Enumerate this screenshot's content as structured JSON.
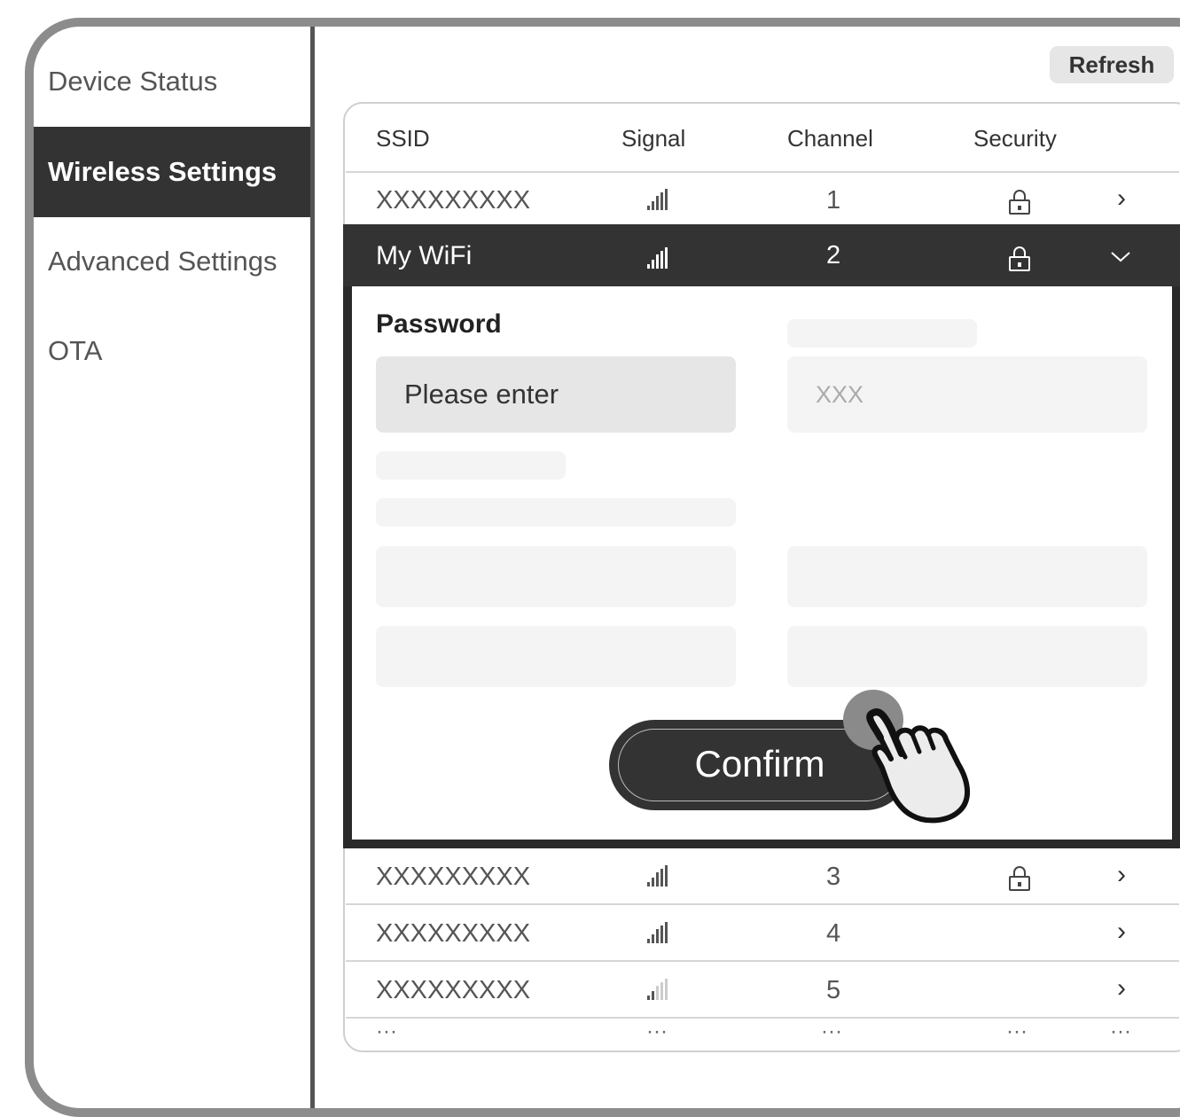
{
  "sidebar": {
    "items": [
      {
        "label": "Device Status",
        "active": false
      },
      {
        "label": "Wireless Settings",
        "active": true
      },
      {
        "label": "Advanced Settings",
        "active": false
      },
      {
        "label": "OTA",
        "active": false
      }
    ]
  },
  "toolbar": {
    "refresh_label": "Refresh"
  },
  "table": {
    "headers": [
      "SSID",
      "Signal",
      "Channel",
      "Security"
    ],
    "rows": [
      {
        "ssid": "XXXXXXXXX",
        "channel": "1",
        "secured": true,
        "signal_bars": 4
      },
      {
        "ssid": "My WiFi",
        "channel": "2",
        "secured": true,
        "signal_bars": 4,
        "expanded": true
      },
      {
        "ssid": "XXXXXXXXX",
        "channel": "3",
        "secured": true,
        "signal_bars": 4
      },
      {
        "ssid": "XXXXXXXXX",
        "channel": "4",
        "secured": false,
        "signal_bars": 4
      },
      {
        "ssid": "XXXXXXXXX",
        "channel": "5",
        "secured": false,
        "signal_bars": 2
      }
    ],
    "more_marker": "···"
  },
  "expanded": {
    "password_label": "Password",
    "password_placeholder": "Please enter",
    "second_field_placeholder": "XXX",
    "confirm_label": "Confirm"
  },
  "icons": {
    "signal": "signal-bars-icon",
    "lock": "lock-icon",
    "chevron_right": "chevron-right-icon",
    "chevron_down": "chevron-down-icon",
    "cursor": "hand-pointer-icon"
  },
  "colors": {
    "accent_dark": "#333333",
    "frame": "#8c8c8c",
    "input_bg": "#e6e6e6",
    "placeholder_bg": "#f4f4f4"
  }
}
